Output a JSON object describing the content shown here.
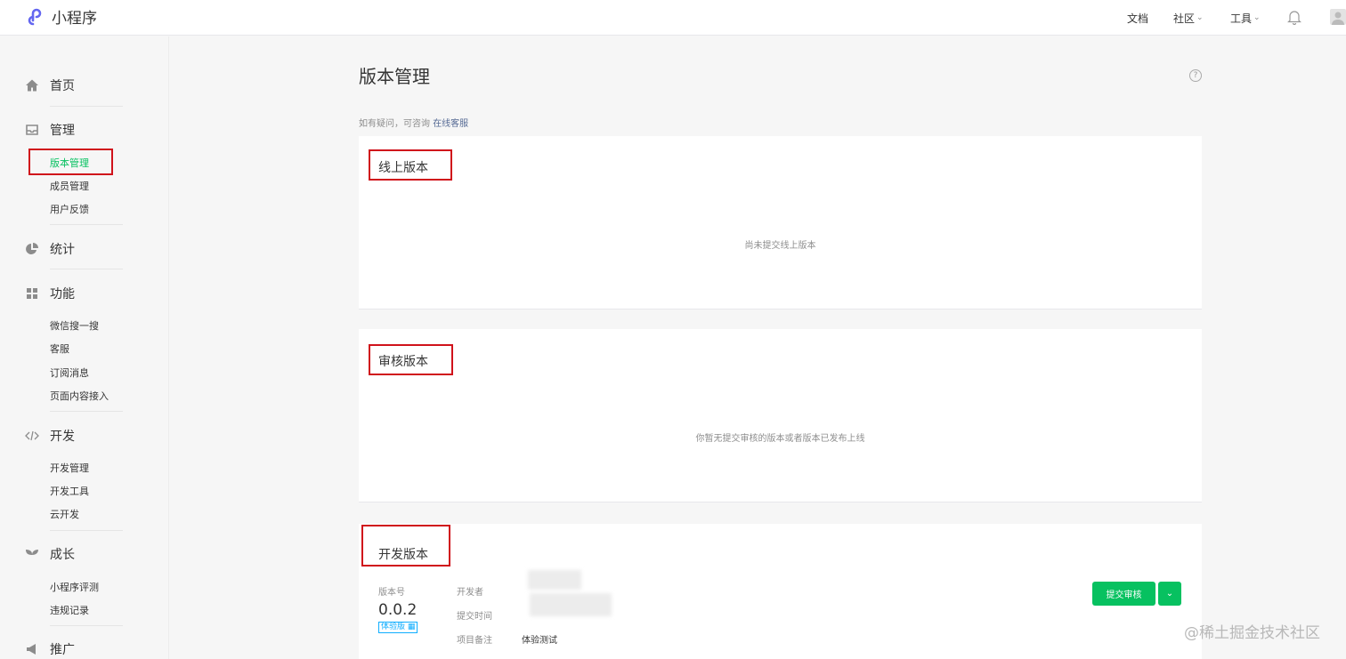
{
  "app": {
    "title": "小程序"
  },
  "topnav": {
    "docs": "文档",
    "community": "社区",
    "tools": "工具"
  },
  "sidebar": {
    "home": "首页",
    "manage": {
      "label": "管理",
      "items": [
        "版本管理",
        "成员管理",
        "用户反馈"
      ]
    },
    "stats": "统计",
    "features": {
      "label": "功能",
      "items": [
        "微信搜一搜",
        "客服",
        "订阅消息",
        "页面内容接入"
      ]
    },
    "develop": {
      "label": "开发",
      "items": [
        "开发管理",
        "开发工具",
        "云开发"
      ]
    },
    "growth": {
      "label": "成长",
      "items": [
        "小程序评测",
        "违规记录"
      ]
    },
    "promote": "推广"
  },
  "main": {
    "title": "版本管理",
    "consult_prefix": "如有疑问，可咨询",
    "consult_link": "在线客服",
    "online": {
      "title": "线上版本",
      "empty": "尚未提交线上版本"
    },
    "review": {
      "title": "审核版本",
      "empty": "你暂无提交审核的版本或者版本已发布上线"
    },
    "dev": {
      "title": "开发版本",
      "version_label": "版本号",
      "version": "0.0.2",
      "badge": "体验版",
      "developer_label": "开发者",
      "submit_time_label": "提交时间",
      "note_label": "项目备注",
      "note": "体验测试",
      "submit_button": "提交审核"
    }
  },
  "watermark": "@稀土掘金技术社区",
  "colors": {
    "accent": "#07c160",
    "highlight_box": "#d0121b",
    "link": "#576b95"
  }
}
